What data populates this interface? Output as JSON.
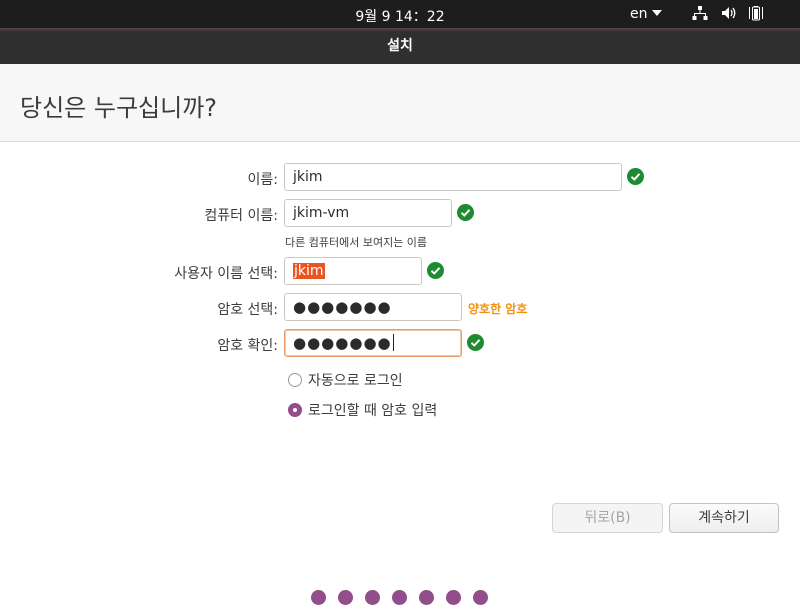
{
  "topbar": {
    "clock": "9월 9  14：22",
    "language": "en"
  },
  "window": {
    "title": "설치"
  },
  "page": {
    "heading": "당신은 누구십니까?"
  },
  "form": {
    "name": {
      "label": "이름:",
      "value": "jkim"
    },
    "computer": {
      "label": "컴퓨터 이름:",
      "value": "jkim-vm",
      "hint": "다른 컴퓨터에서 보여지는 이름"
    },
    "username": {
      "label": "사용자 이름 선택:",
      "value": "jkim"
    },
    "password": {
      "label": "암호 선택:",
      "value": "●●●●●●●",
      "strength": "양호한 암호"
    },
    "confirm": {
      "label": "암호 확인:",
      "value": "●●●●●●●"
    },
    "login_options": [
      {
        "label": "자동으로 로그인",
        "selected": false
      },
      {
        "label": "로그인할 때 암호 입력",
        "selected": true
      }
    ]
  },
  "buttons": {
    "back": "뒤로(B)",
    "continue": "계속하기"
  },
  "colors": {
    "accent": "#924d8b",
    "valid": "#1e8a32",
    "strength": "#f29111",
    "selection": "#e95420"
  },
  "icons": [
    "network-icon",
    "volume-icon",
    "battery-icon",
    "checkmark-icon"
  ]
}
